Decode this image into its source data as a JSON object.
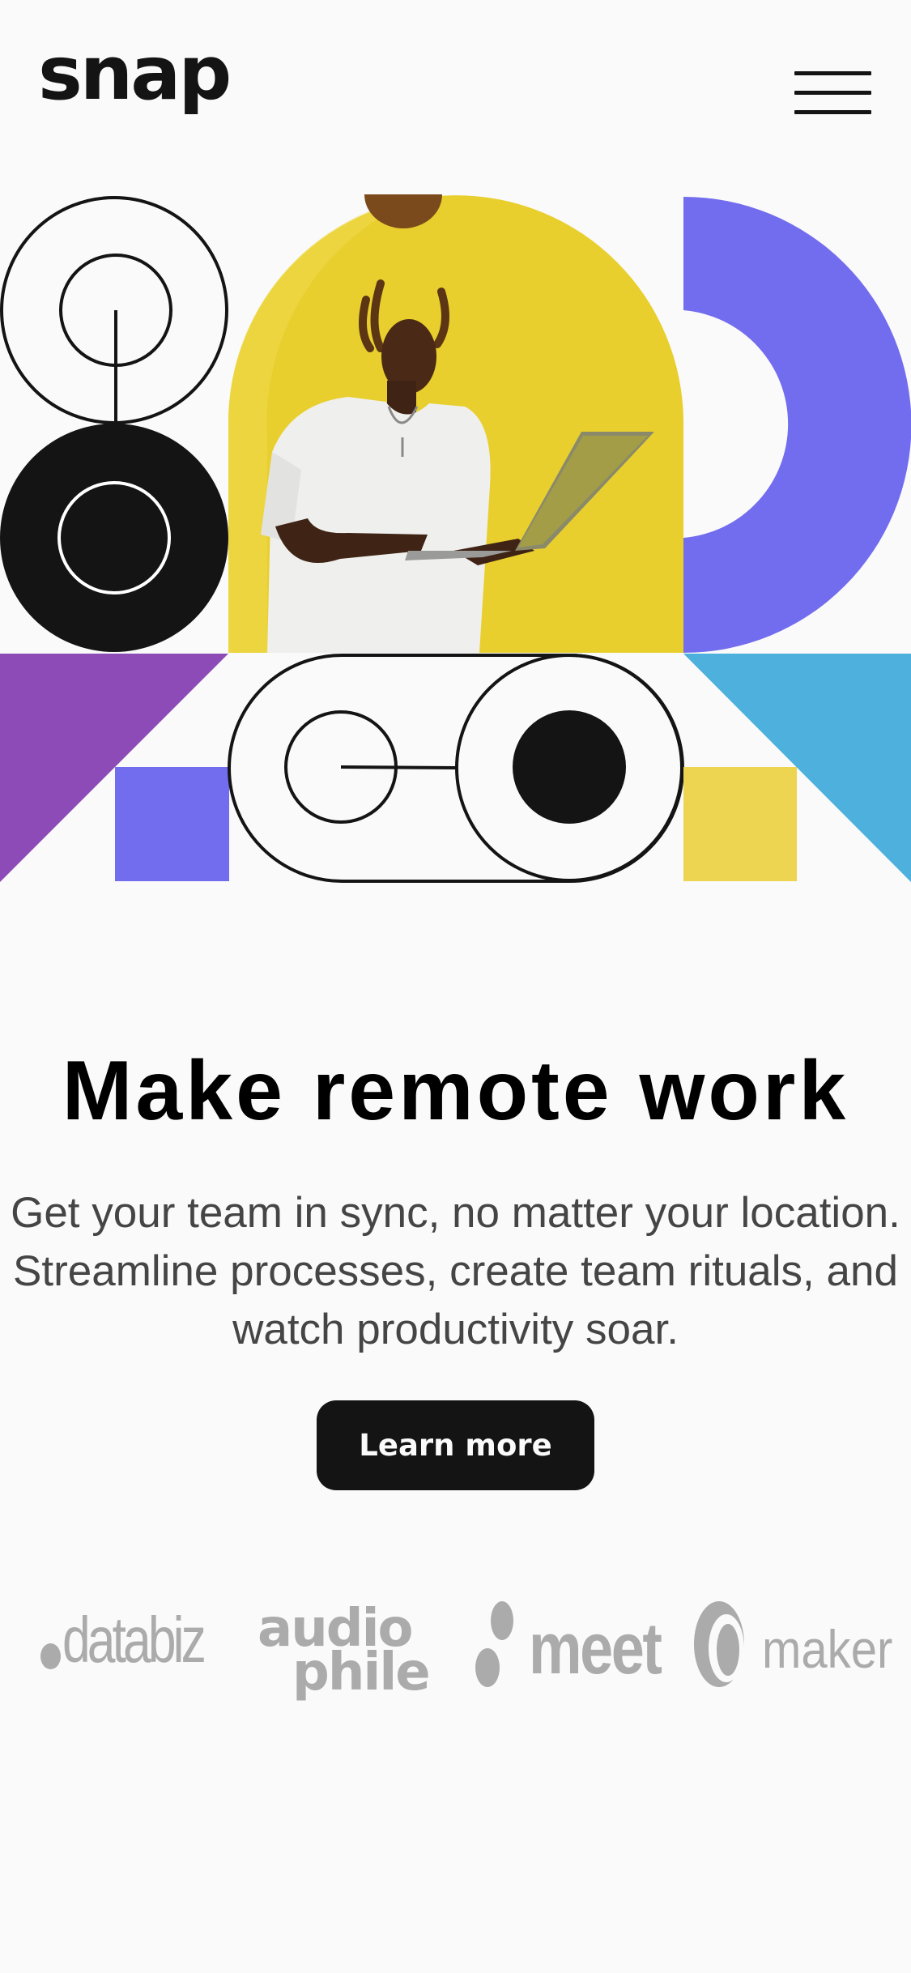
{
  "header": {
    "logo": "snap",
    "menu_icon": "hamburger-icon"
  },
  "hero": {
    "colors": {
      "yellow": "#e8cf2e",
      "violet": "#726cee",
      "purple": "#8d4bb7",
      "blue": "#4db0dd",
      "dark": "#141414"
    }
  },
  "main": {
    "headline": "Make remote work",
    "subtext": "Get your team in sync, no matter your location. Streamline processes, create team rituals, and watch productivity soar.",
    "cta_label": "Learn more"
  },
  "clients": {
    "databiz": "databiz",
    "audiophile_line1": "audio",
    "audiophile_line2": "phile",
    "meet": "meet",
    "maker": "maker"
  }
}
